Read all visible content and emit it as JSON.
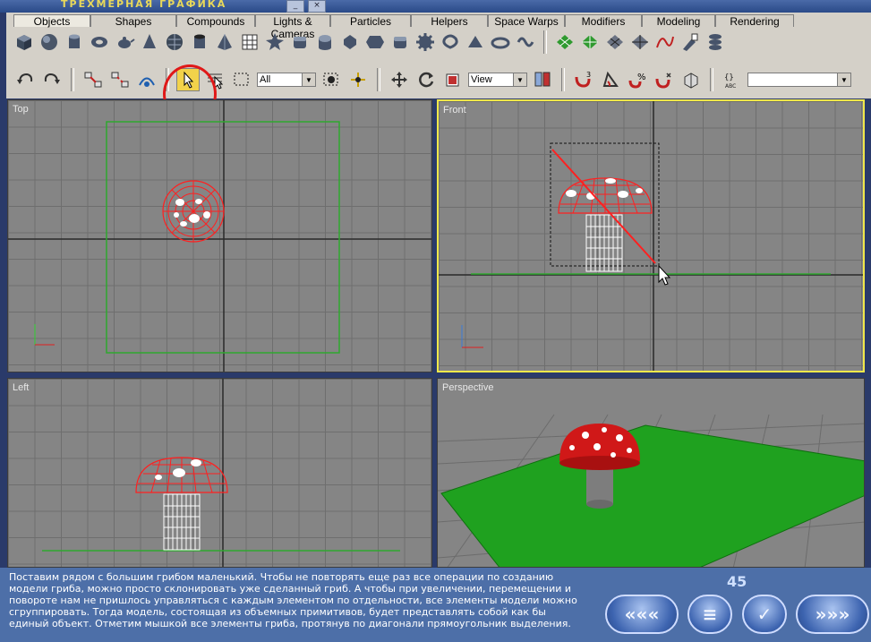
{
  "window": {
    "title": "ТРЕХМЕРНАЯ ГРАФИКА",
    "min_label": "_",
    "close_label": "×"
  },
  "tabs": [
    {
      "label": "Objects"
    },
    {
      "label": "Shapes"
    },
    {
      "label": "Compounds"
    },
    {
      "label": "Lights & Cameras"
    },
    {
      "label": "Particles"
    },
    {
      "label": "Helpers"
    },
    {
      "label": "Space Warps"
    },
    {
      "label": "Modifiers"
    },
    {
      "label": "Modeling"
    },
    {
      "label": "Rendering"
    }
  ],
  "create_icons": [
    "box-icon",
    "sphere-icon",
    "cylinder-icon",
    "torus-icon",
    "teapot-icon",
    "cone-icon",
    "geosphere-icon",
    "tube-icon",
    "pyramid-icon",
    "plane-icon",
    "hedra-icon",
    "chamferbox-icon",
    "oiltank-icon",
    "spindle-icon",
    "gengon-icon",
    "chamfercyl-icon",
    "gear-icon",
    "torusknot-icon",
    "prism-icon",
    "ringwave-icon",
    "hose-icon",
    "patch-grid-icon",
    "tri-patch-icon",
    "nurbs-surface-icon",
    "cv-surface-icon",
    "nurbs-curve-icon",
    "paint-icon",
    "stack-icon"
  ],
  "toolbar": {
    "filter_value": "All",
    "coord_value": "View",
    "named_selection_value": "",
    "snap_label": "3",
    "active_tool": "select-object"
  },
  "viewports": {
    "top": "Top",
    "front": "Front",
    "left": "Left",
    "perspective": "Perspective"
  },
  "colors": {
    "wireframe": "#ff2020",
    "ground": "#2fa82f",
    "grid_bg": "#858585",
    "active_border": "#f0e84a"
  },
  "lesson": {
    "text": "Поставим рядом с большим грибом маленький. Чтобы не повторять еще раз все операции по созданию модели гриба, можно просто склонировать уже сделанный гриб. А чтобы при увеличении, перемещении и повороте нам не пришлось управляться с каждым элементом по отдельности, все элементы модели можно сгруппировать. Тогда модель, состоящая из объемных примитивов, будет представлять собой как бы единый объект. Отметим мышкой все элементы гриба, протянув по диагонали прямоугольник выделения.",
    "page": "45"
  },
  "nav": {
    "back_label": "«««",
    "contents_label": "≡",
    "check_label": "✓",
    "forward_label": "»»»"
  }
}
